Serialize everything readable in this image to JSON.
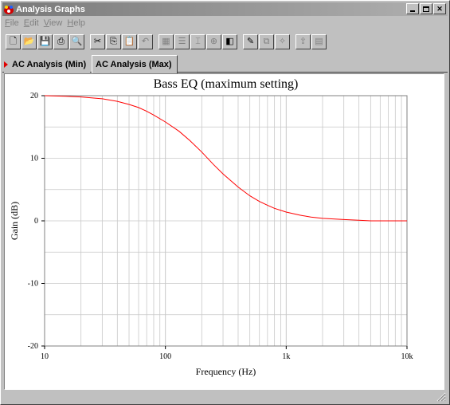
{
  "window": {
    "title": "Analysis Graphs"
  },
  "menu": {
    "items": [
      "File",
      "Edit",
      "View",
      "Help"
    ],
    "underline": [
      "F",
      "E",
      "V",
      "H"
    ]
  },
  "toolbar": {
    "buttons": [
      {
        "icon": "new-icon",
        "group_start": false,
        "enabled": true
      },
      {
        "icon": "open-icon",
        "group_start": false,
        "enabled": true
      },
      {
        "icon": "save-icon",
        "group_start": false,
        "enabled": true
      },
      {
        "icon": "print-icon",
        "group_start": false,
        "enabled": true
      },
      {
        "icon": "print-preview-icon",
        "group_start": false,
        "enabled": true
      },
      {
        "icon": "cut-icon",
        "group_start": true,
        "enabled": true
      },
      {
        "icon": "copy-icon",
        "group_start": false,
        "enabled": true
      },
      {
        "icon": "paste-icon",
        "group_start": false,
        "enabled": false
      },
      {
        "icon": "undo-icon",
        "group_start": false,
        "enabled": false
      },
      {
        "icon": "grid-icon",
        "group_start": true,
        "enabled": false
      },
      {
        "icon": "legend-icon",
        "group_start": false,
        "enabled": false
      },
      {
        "icon": "cursors-icon",
        "group_start": false,
        "enabled": false
      },
      {
        "icon": "zoom-icon",
        "group_start": false,
        "enabled": false
      },
      {
        "icon": "reverse-colors-icon",
        "group_start": false,
        "enabled": true
      },
      {
        "icon": "properties-icon",
        "group_start": true,
        "enabled": true
      },
      {
        "icon": "overlay-icon",
        "group_start": false,
        "enabled": false
      },
      {
        "icon": "select-marks-icon",
        "group_start": false,
        "enabled": false
      },
      {
        "icon": "export-icon",
        "group_start": true,
        "enabled": false
      },
      {
        "icon": "export-excel-icon",
        "group_start": false,
        "enabled": false
      }
    ]
  },
  "tabs": [
    {
      "label": "AC Analysis (Min)",
      "active": false
    },
    {
      "label": "AC Analysis (Max)",
      "active": true
    }
  ],
  "colors": {
    "trace": "#ff0000",
    "grid": "#c8c8c8",
    "tab_marker": "#e00000"
  },
  "chart_data": {
    "type": "line",
    "title": "Bass EQ (maximum setting)",
    "xlabel": "Frequency (Hz)",
    "ylabel": "Gain (dB)",
    "xscale": "log",
    "xlim": [
      10,
      10000
    ],
    "ylim": [
      -20,
      20
    ],
    "xticks": [
      10,
      100,
      1000,
      10000
    ],
    "xtick_labels": [
      "10",
      "100",
      "1k",
      "10k"
    ],
    "yticks": [
      -20,
      -10,
      0,
      10,
      20
    ],
    "ytick_labels": [
      "-20",
      "-10",
      "0",
      "10",
      "20"
    ],
    "grid": true,
    "series": [
      {
        "x": [
          10,
          15,
          20,
          30,
          40,
          50,
          60,
          70,
          80,
          100,
          130,
          160,
          200,
          250,
          300,
          400,
          500,
          600,
          700,
          800,
          1000,
          1300,
          1600,
          2000,
          3000,
          4000,
          5000,
          7000,
          10000
        ],
        "y": [
          20.0,
          19.9,
          19.8,
          19.5,
          19.1,
          18.6,
          18.1,
          17.5,
          16.9,
          15.8,
          14.3,
          12.8,
          11.0,
          9.0,
          7.5,
          5.4,
          4.0,
          3.1,
          2.5,
          2.0,
          1.4,
          0.9,
          0.6,
          0.4,
          0.2,
          0.1,
          0.0,
          0.0,
          0.0
        ]
      }
    ]
  }
}
